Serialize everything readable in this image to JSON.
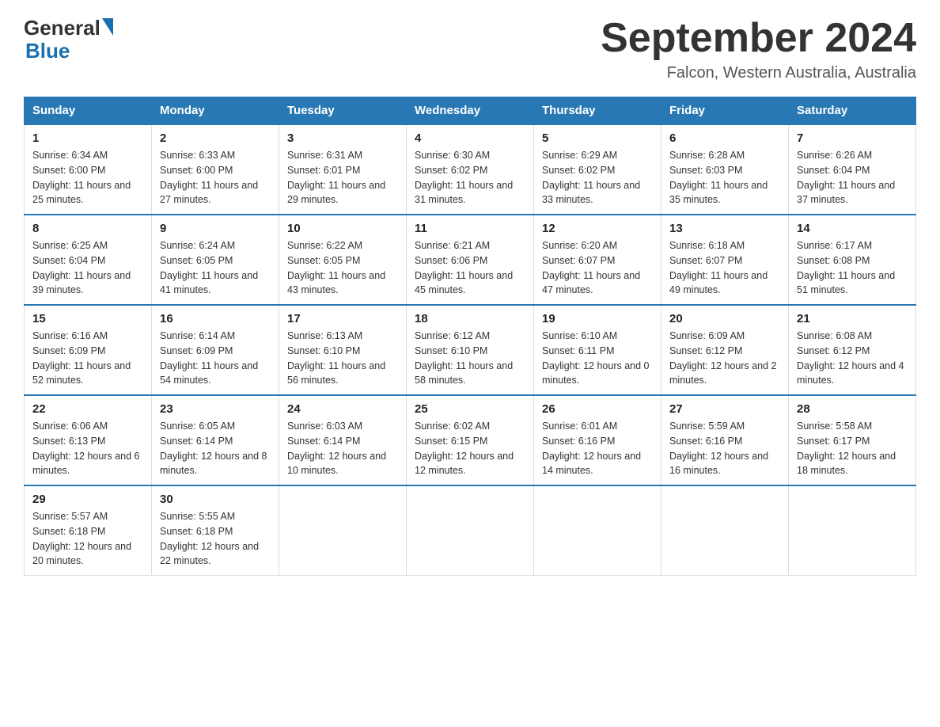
{
  "header": {
    "logo": {
      "general": "General",
      "blue": "Blue",
      "triangle": "▶"
    },
    "title": "September 2024",
    "location": "Falcon, Western Australia, Australia"
  },
  "days_of_week": [
    "Sunday",
    "Monday",
    "Tuesday",
    "Wednesday",
    "Thursday",
    "Friday",
    "Saturday"
  ],
  "weeks": [
    [
      {
        "day": "1",
        "sunrise": "6:34 AM",
        "sunset": "6:00 PM",
        "daylight": "11 hours and 25 minutes."
      },
      {
        "day": "2",
        "sunrise": "6:33 AM",
        "sunset": "6:00 PM",
        "daylight": "11 hours and 27 minutes."
      },
      {
        "day": "3",
        "sunrise": "6:31 AM",
        "sunset": "6:01 PM",
        "daylight": "11 hours and 29 minutes."
      },
      {
        "day": "4",
        "sunrise": "6:30 AM",
        "sunset": "6:02 PM",
        "daylight": "11 hours and 31 minutes."
      },
      {
        "day": "5",
        "sunrise": "6:29 AM",
        "sunset": "6:02 PM",
        "daylight": "11 hours and 33 minutes."
      },
      {
        "day": "6",
        "sunrise": "6:28 AM",
        "sunset": "6:03 PM",
        "daylight": "11 hours and 35 minutes."
      },
      {
        "day": "7",
        "sunrise": "6:26 AM",
        "sunset": "6:04 PM",
        "daylight": "11 hours and 37 minutes."
      }
    ],
    [
      {
        "day": "8",
        "sunrise": "6:25 AM",
        "sunset": "6:04 PM",
        "daylight": "11 hours and 39 minutes."
      },
      {
        "day": "9",
        "sunrise": "6:24 AM",
        "sunset": "6:05 PM",
        "daylight": "11 hours and 41 minutes."
      },
      {
        "day": "10",
        "sunrise": "6:22 AM",
        "sunset": "6:05 PM",
        "daylight": "11 hours and 43 minutes."
      },
      {
        "day": "11",
        "sunrise": "6:21 AM",
        "sunset": "6:06 PM",
        "daylight": "11 hours and 45 minutes."
      },
      {
        "day": "12",
        "sunrise": "6:20 AM",
        "sunset": "6:07 PM",
        "daylight": "11 hours and 47 minutes."
      },
      {
        "day": "13",
        "sunrise": "6:18 AM",
        "sunset": "6:07 PM",
        "daylight": "11 hours and 49 minutes."
      },
      {
        "day": "14",
        "sunrise": "6:17 AM",
        "sunset": "6:08 PM",
        "daylight": "11 hours and 51 minutes."
      }
    ],
    [
      {
        "day": "15",
        "sunrise": "6:16 AM",
        "sunset": "6:09 PM",
        "daylight": "11 hours and 52 minutes."
      },
      {
        "day": "16",
        "sunrise": "6:14 AM",
        "sunset": "6:09 PM",
        "daylight": "11 hours and 54 minutes."
      },
      {
        "day": "17",
        "sunrise": "6:13 AM",
        "sunset": "6:10 PM",
        "daylight": "11 hours and 56 minutes."
      },
      {
        "day": "18",
        "sunrise": "6:12 AM",
        "sunset": "6:10 PM",
        "daylight": "11 hours and 58 minutes."
      },
      {
        "day": "19",
        "sunrise": "6:10 AM",
        "sunset": "6:11 PM",
        "daylight": "12 hours and 0 minutes."
      },
      {
        "day": "20",
        "sunrise": "6:09 AM",
        "sunset": "6:12 PM",
        "daylight": "12 hours and 2 minutes."
      },
      {
        "day": "21",
        "sunrise": "6:08 AM",
        "sunset": "6:12 PM",
        "daylight": "12 hours and 4 minutes."
      }
    ],
    [
      {
        "day": "22",
        "sunrise": "6:06 AM",
        "sunset": "6:13 PM",
        "daylight": "12 hours and 6 minutes."
      },
      {
        "day": "23",
        "sunrise": "6:05 AM",
        "sunset": "6:14 PM",
        "daylight": "12 hours and 8 minutes."
      },
      {
        "day": "24",
        "sunrise": "6:03 AM",
        "sunset": "6:14 PM",
        "daylight": "12 hours and 10 minutes."
      },
      {
        "day": "25",
        "sunrise": "6:02 AM",
        "sunset": "6:15 PM",
        "daylight": "12 hours and 12 minutes."
      },
      {
        "day": "26",
        "sunrise": "6:01 AM",
        "sunset": "6:16 PM",
        "daylight": "12 hours and 14 minutes."
      },
      {
        "day": "27",
        "sunrise": "5:59 AM",
        "sunset": "6:16 PM",
        "daylight": "12 hours and 16 minutes."
      },
      {
        "day": "28",
        "sunrise": "5:58 AM",
        "sunset": "6:17 PM",
        "daylight": "12 hours and 18 minutes."
      }
    ],
    [
      {
        "day": "29",
        "sunrise": "5:57 AM",
        "sunset": "6:18 PM",
        "daylight": "12 hours and 20 minutes."
      },
      {
        "day": "30",
        "sunrise": "5:55 AM",
        "sunset": "6:18 PM",
        "daylight": "12 hours and 22 minutes."
      },
      null,
      null,
      null,
      null,
      null
    ]
  ],
  "labels": {
    "sunrise_prefix": "Sunrise: ",
    "sunset_prefix": "Sunset: ",
    "daylight_prefix": "Daylight: "
  }
}
